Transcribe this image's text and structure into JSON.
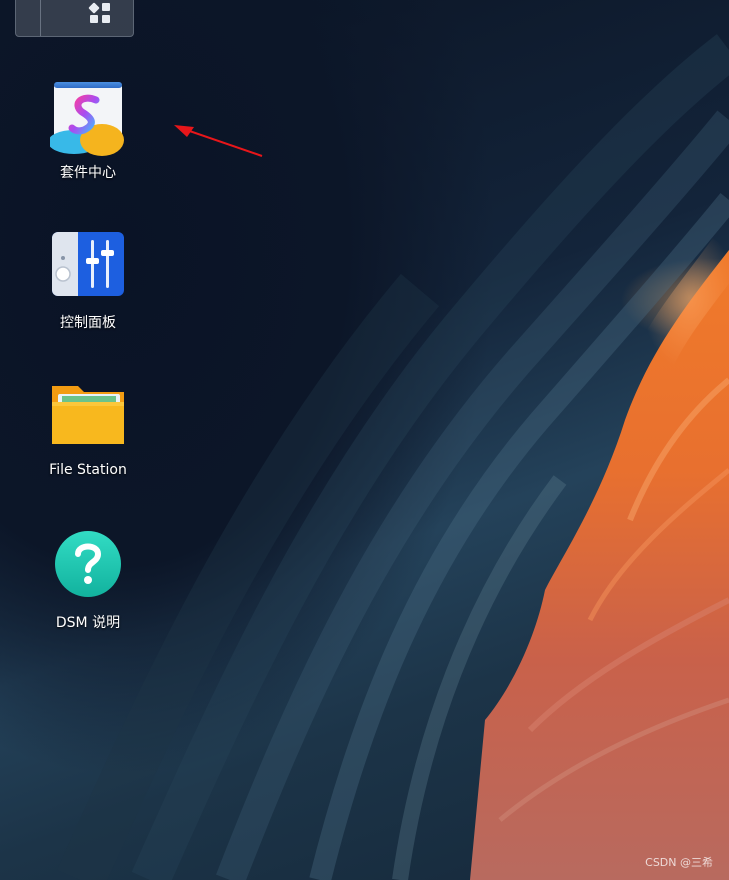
{
  "desktop": {
    "icons": [
      {
        "label": "套件中心",
        "icon": "package-center-icon"
      },
      {
        "label": "控制面板",
        "icon": "control-panel-icon"
      },
      {
        "label": "File Station",
        "icon": "folder-icon"
      },
      {
        "label": "DSM 说明",
        "icon": "help-icon"
      }
    ],
    "taskbar": {
      "icon": "app-grid-icon"
    }
  },
  "watermark": "CSDN @三希",
  "colors": {
    "annotation_arrow": "#e8161a",
    "help_icon": "#1ec6b0",
    "folder": "#f8b81e",
    "control_panel": "#1d5fe0"
  }
}
